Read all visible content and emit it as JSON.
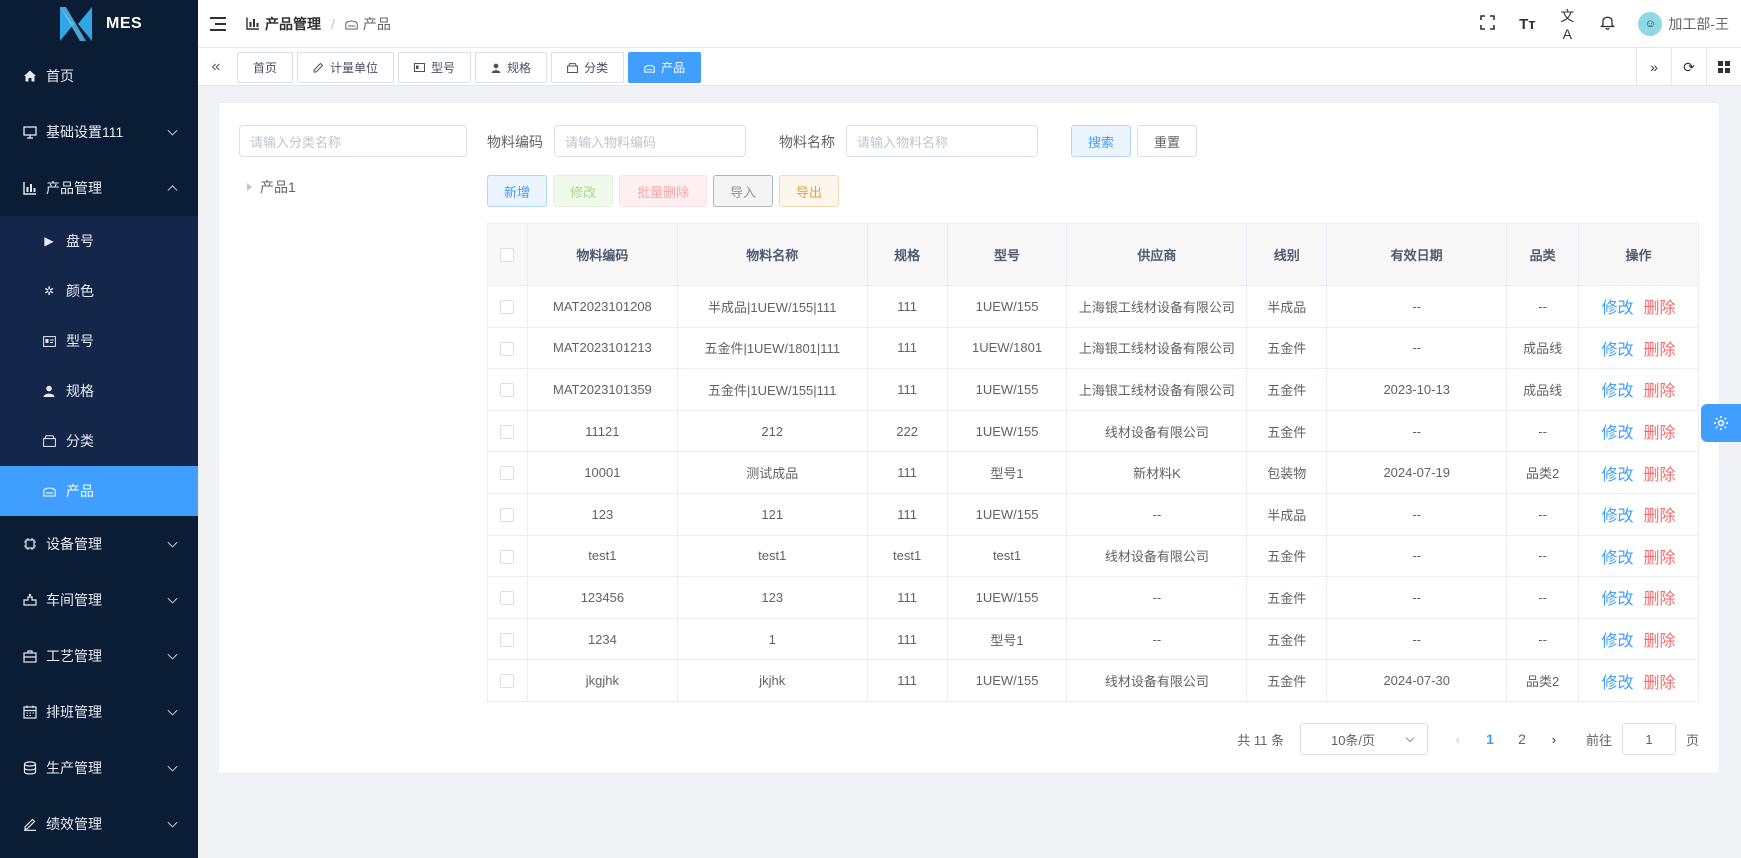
{
  "app": {
    "name": "MES"
  },
  "sidebar": {
    "items": [
      {
        "label": "首页",
        "icon": "home-icon"
      },
      {
        "label": "基础设置111",
        "icon": "monitor-icon"
      },
      {
        "label": "产品管理",
        "icon": "chart-icon"
      },
      {
        "label": "设备管理",
        "icon": "chip-icon"
      },
      {
        "label": "车间管理",
        "icon": "workshop-icon"
      },
      {
        "label": "工艺管理",
        "icon": "briefcase-icon"
      },
      {
        "label": "排班管理",
        "icon": "calendar-icon"
      },
      {
        "label": "生产管理",
        "icon": "database-icon"
      },
      {
        "label": "绩效管理",
        "icon": "edit-icon"
      }
    ],
    "submenu": [
      {
        "label": "盘号",
        "icon": "play-icon"
      },
      {
        "label": "颜色",
        "icon": "palette-icon"
      },
      {
        "label": "型号",
        "icon": "id-card-icon"
      },
      {
        "label": "规格",
        "icon": "user-icon"
      },
      {
        "label": "分类",
        "icon": "box-icon"
      },
      {
        "label": "产品",
        "icon": "product-icon"
      }
    ]
  },
  "header": {
    "breadcrumb": {
      "parent": "产品管理",
      "current": "产品"
    },
    "user": "加工部-王"
  },
  "tags": [
    "首页",
    "计量单位",
    "型号",
    "规格",
    "分类",
    "产品"
  ],
  "filters": {
    "tree_search_placeholder": "请输入分类名称",
    "code_label": "物料编码",
    "code_placeholder": "请输入物料编码",
    "name_label": "物料名称",
    "name_placeholder": "请输入物料名称",
    "search": "搜索",
    "reset": "重置"
  },
  "tree": {
    "node": "产品1"
  },
  "actions": {
    "add": "新增",
    "edit": "修改",
    "batch_delete": "批量删除",
    "import": "导入",
    "export": "导出"
  },
  "table": {
    "headers": [
      "物料编码",
      "物料名称",
      "规格",
      "型号",
      "供应商",
      "线别",
      "有效日期",
      "品类",
      "操作"
    ],
    "edit_label": "修改",
    "delete_label": "删除",
    "rows": [
      {
        "code": "MAT2023101208",
        "name": "半成品|1UEW/155|111",
        "spec": "111",
        "model": "1UEW/155",
        "supplier": "上海银工线材设备有限公司",
        "line": "半成品",
        "date": "--",
        "category": "--"
      },
      {
        "code": "MAT2023101213",
        "name": "五金件|1UEW/1801|111",
        "spec": "111",
        "model": "1UEW/1801",
        "supplier": "上海银工线材设备有限公司",
        "line": "五金件",
        "date": "--",
        "category": "成品线"
      },
      {
        "code": "MAT2023101359",
        "name": "五金件|1UEW/155|111",
        "spec": "111",
        "model": "1UEW/155",
        "supplier": "上海银工线材设备有限公司",
        "line": "五金件",
        "date": "2023-10-13",
        "category": "成品线"
      },
      {
        "code": "11121",
        "name": "212",
        "spec": "222",
        "model": "1UEW/155",
        "supplier": "线材设备有限公司",
        "line": "五金件",
        "date": "--",
        "category": "--"
      },
      {
        "code": "10001",
        "name": "测试成品",
        "spec": "111",
        "model": "型号1",
        "supplier": "新材料K",
        "line": "包装物",
        "date": "2024-07-19",
        "category": "品类2"
      },
      {
        "code": "123",
        "name": "121",
        "spec": "111",
        "model": "1UEW/155",
        "supplier": "--",
        "line": "半成品",
        "date": "--",
        "category": "--"
      },
      {
        "code": "test1",
        "name": "test1",
        "spec": "test1",
        "model": "test1",
        "supplier": "线材设备有限公司",
        "line": "五金件",
        "date": "--",
        "category": "--"
      },
      {
        "code": "123456",
        "name": "123",
        "spec": "111",
        "model": "1UEW/155",
        "supplier": "--",
        "line": "五金件",
        "date": "--",
        "category": "--"
      },
      {
        "code": "1234",
        "name": "1",
        "spec": "111",
        "model": "型号1",
        "supplier": "--",
        "line": "五金件",
        "date": "--",
        "category": "--"
      },
      {
        "code": "jkgjhk",
        "name": "jkjhk",
        "spec": "111",
        "model": "1UEW/155",
        "supplier": "线材设备有限公司",
        "line": "五金件",
        "date": "2024-07-30",
        "category": "品类2"
      }
    ]
  },
  "pagination": {
    "total": "共 11 条",
    "page_size": "10条/页",
    "pages": [
      "1",
      "2"
    ],
    "current_page": "1",
    "goto_label": "前往",
    "goto_value": "1",
    "page_suffix": "页"
  },
  "colors": {
    "primary": "#409eff",
    "danger": "#f56c6c",
    "sidebar_bg": "#0b1c35"
  }
}
